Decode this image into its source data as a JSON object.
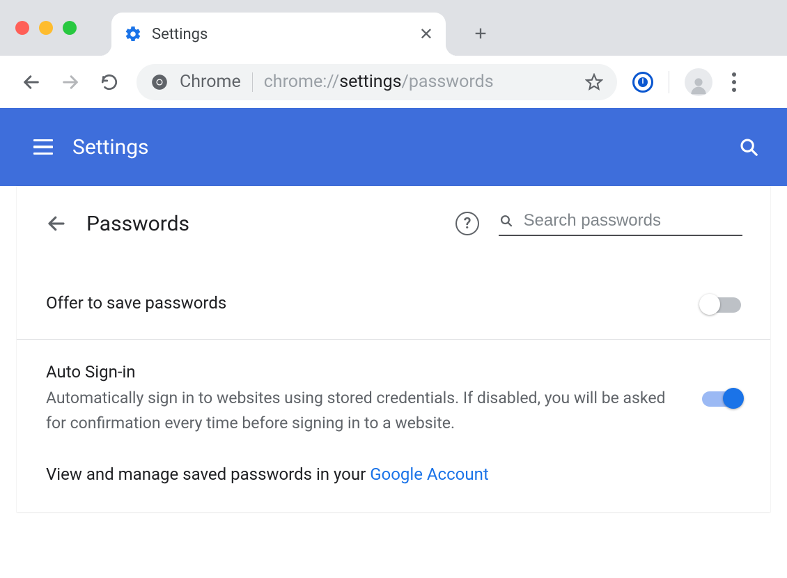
{
  "browser": {
    "tab_title": "Settings",
    "omnibox": {
      "chip": "Chrome",
      "url_prefix": "chrome://",
      "url_bold": "settings",
      "url_suffix": "/passwords"
    }
  },
  "header": {
    "title": "Settings"
  },
  "page": {
    "title": "Passwords",
    "search_placeholder": "Search passwords",
    "settings": {
      "offer_save": {
        "title": "Offer to save passwords",
        "enabled": false
      },
      "auto_signin": {
        "title": "Auto Sign-in",
        "subtitle": "Automatically sign in to websites using stored credentials. If disabled, you will be asked for confirmation every time before signing in to a website.",
        "enabled": true
      }
    },
    "manage_text": "View and manage saved passwords in your ",
    "manage_link": "Google Account"
  }
}
